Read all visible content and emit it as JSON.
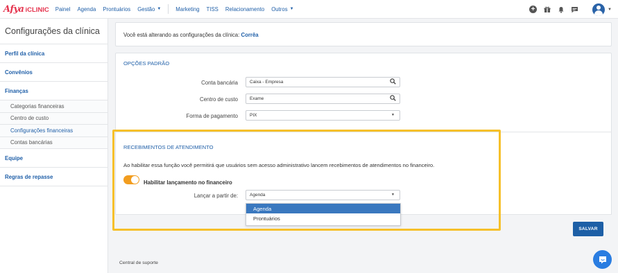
{
  "brand": {
    "afya": "Afya",
    "iclinic": "iCLINIC"
  },
  "nav": [
    {
      "label": "Painel"
    },
    {
      "label": "Agenda"
    },
    {
      "label": "Prontuários"
    },
    {
      "label": "Gestão",
      "chevron": true
    },
    {
      "label": "Marketing"
    },
    {
      "label": "TISS"
    },
    {
      "label": "Relacionamento"
    },
    {
      "label": "Outros",
      "chevron": true
    }
  ],
  "top_icons": [
    "add-icon",
    "gift-icon",
    "bell-icon",
    "message-icon",
    "user-avatar"
  ],
  "sidebar": {
    "title": "Configurações da clínica",
    "items": {
      "perfil": "Perfil da clínica",
      "convenios": "Convênios",
      "financas": "Finanças",
      "categorias": "Categorias financeiras",
      "centro": "Centro de custo",
      "config_fin": "Configurações financeiras",
      "contas": "Contas bancárias",
      "equipe": "Equipe",
      "repasse": "Regras de repasse"
    }
  },
  "alert": {
    "prefix": "Você está alterando as configurações da clínica:",
    "clinic": "Corrêa"
  },
  "opcoes": {
    "title": "OPÇÕES PADRÃO",
    "conta_label": "Conta bancária",
    "conta_value": "Caixa - Empresa",
    "centro_label": "Centro de custo",
    "centro_value": "Exame",
    "forma_label": "Forma de pagamento",
    "forma_value": "PIX"
  },
  "recebimentos": {
    "title": "RECEBIMENTOS DE ATENDIMENTO",
    "description": "Ao habilitar essa função você permitirá que usuários sem acesso administrativo lancem recebimentos de atendimentos no financeiro.",
    "toggle_label": "Habilitar lançamento no financeiro",
    "toggle_on": true,
    "lancar_label": "Lançar a partir de:",
    "lancar_value": "Agenda",
    "options": [
      "Agenda",
      "Prontuários"
    ]
  },
  "save_label": "SALVAR",
  "footer": {
    "support": "Central de suporte"
  },
  "colors": {
    "primary": "#1d5fa6",
    "toggle": "#f29d1f",
    "highlight": "#f6c02a",
    "brand": "#e5344e"
  }
}
